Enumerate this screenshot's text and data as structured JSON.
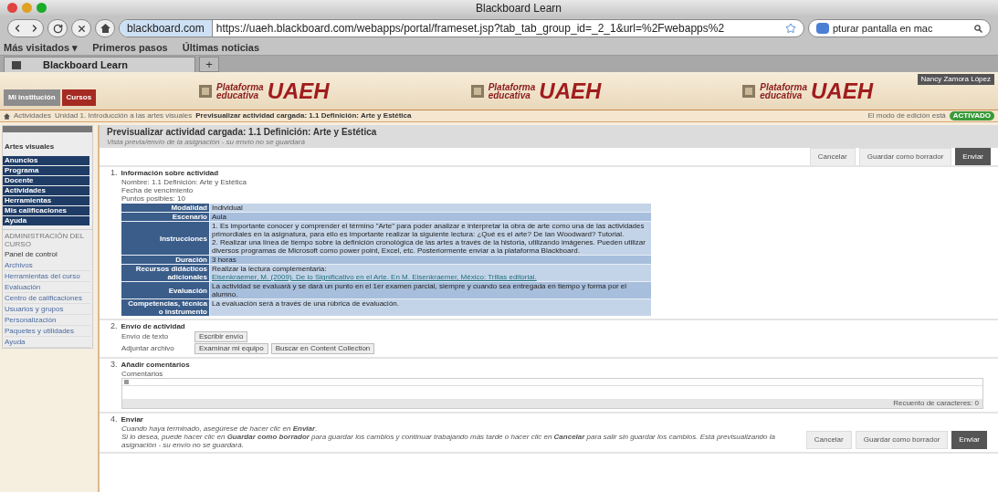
{
  "window": {
    "title": "Blackboard Learn"
  },
  "toolbar": {
    "site_label": "blackboard.com",
    "url": "https://uaeh.blackboard.com/webapps/portal/frameset.jsp?tab_tab_group_id=_2_1&url=%2Fwebapps%2",
    "search_value": "pturar pantalla en mac"
  },
  "bookmarks": [
    {
      "label": "Más visitados ▾"
    },
    {
      "label": "Primeros pasos"
    },
    {
      "label": "Últimas noticias"
    }
  ],
  "tabs": [
    {
      "label": "Blackboard Learn",
      "selected": true
    }
  ],
  "new_tab": "+",
  "header": {
    "nav_tabs": [
      {
        "label": "Mi institución",
        "selected": false
      },
      {
        "label": "Cursos",
        "selected": true
      }
    ],
    "logos": [
      {
        "line1": "Plataforma",
        "line2": "educativa",
        "brand": "UAEH"
      },
      {
        "line1": "Plataforma",
        "line2": "educativa",
        "brand": "UAEH"
      },
      {
        "line1": "Plataforma",
        "line2": "educativa",
        "brand": "UAEH"
      }
    ],
    "user": "Nancy Zamora López",
    "breadcrumb": [
      "Actividades",
      "Unidad 1. Introducción a las artes visuales",
      "Previsualizar actividad cargada: 1.1 Definición: Arte y Estética"
    ],
    "edit_mode_label": "El modo de edición está",
    "edit_mode": "ACTIVADO"
  },
  "sidebar": {
    "course": "Artes visuales",
    "items": [
      {
        "label": "Anuncios"
      },
      {
        "label": "Programa"
      },
      {
        "label": "Docente"
      },
      {
        "label": "Actividades"
      },
      {
        "label": "Herramientas"
      },
      {
        "label": "Mis calificaciones"
      },
      {
        "label": "Ayuda"
      }
    ],
    "admin_heading": "ADMINISTRACIÓN DEL CURSO",
    "panel_title": "Panel de control",
    "panel_items": [
      {
        "label": "Archivos"
      },
      {
        "label": "Herramientas del curso"
      },
      {
        "label": "Evaluación"
      },
      {
        "label": "Centro de calificaciones"
      },
      {
        "label": "Usuarios y grupos"
      },
      {
        "label": "Personalización"
      },
      {
        "label": "Paquetes y utilidades"
      },
      {
        "label": "Ayuda"
      }
    ]
  },
  "page": {
    "title": "Previsualizar actividad cargada: 1.1 Definición: Arte y Estética",
    "subtitle": "Vista previa/envío de la asignación - su envío no se guardará",
    "buttons": [
      "Cancelar",
      "Guardar como borrador",
      "Enviar"
    ]
  },
  "sections": [
    {
      "number": "1.",
      "title": "Información sobre actividad",
      "meta": [
        "Nombre: 1.1 Definición: Arte y Estética",
        "Fecha de vencimiento",
        "Puntos posibles: 10"
      ],
      "rows": [
        {
          "label": "Modalidad",
          "value": "Individual"
        },
        {
          "label": "Escenario",
          "value": "Aula"
        },
        {
          "label": "Instrucciones",
          "value": "1. Es importante conocer y comprender el término \"Arte\" para poder analizar e interpretar la obra de arte como una de las actividades primordiales en la asignatura, para ello es importante realizar la siguiente lectura: ¿Qué es el arte? De Ian Woodward? Tutorial.\n2. Realizar una línea de tiempo sobre la definición cronológica de las artes a través de la historia, utilizando imágenes. Pueden utilizar diversos programas de Microsoft como power point, Excel, etc. Posteriormente enviar a la plataforma Blackboard."
        },
        {
          "label": "Duración",
          "value": "3 horas"
        },
        {
          "label": "Recursos didácticos adicionales",
          "value": "Realizar la lectura complementaria:",
          "link": "Eisenkraemer, M. (2009). De lo Significativo en el Arte. En M. Eisenkraemer, México: Trillas editorial."
        },
        {
          "label": "Evaluación",
          "value": "La actividad se evaluará y se dará un punto en el 1er examen parcial, siempre y cuando sea entregada en tiempo y forma por el alumno."
        },
        {
          "label": "Competencias, técnica o instrumento",
          "value": "La evaluación será a través de una rúbrica de evaluación."
        }
      ]
    },
    {
      "number": "2.",
      "title": "Envío de actividad",
      "fields": [
        {
          "label": "Envío de texto",
          "buttons": [
            "Escribir envío"
          ]
        },
        {
          "label": "Adjuntar archivo",
          "buttons": [
            "Examinar mi equipo",
            "Buscar en Content Collection"
          ]
        }
      ]
    },
    {
      "number": "3.",
      "title": "Añadir comentarios",
      "editor_label": "Comentarios",
      "counter": "Recuento de caracteres: 0"
    },
    {
      "number": "4.",
      "title": "Enviar",
      "lines": [
        "Cuando haya terminado, asegúrese de hacer clic en **Enviar**.",
        "Si lo desea, puede hacer clic en **Guardar como borrador** para guardar los cambios y continuar trabajando más tarde o hacer clic en **Cancelar** para salir sin guardar los cambios. Está previsualizando la asignación - su envío no se guardará."
      ],
      "buttons": [
        "Cancelar",
        "Guardar como borrador",
        "Enviar"
      ]
    }
  ]
}
